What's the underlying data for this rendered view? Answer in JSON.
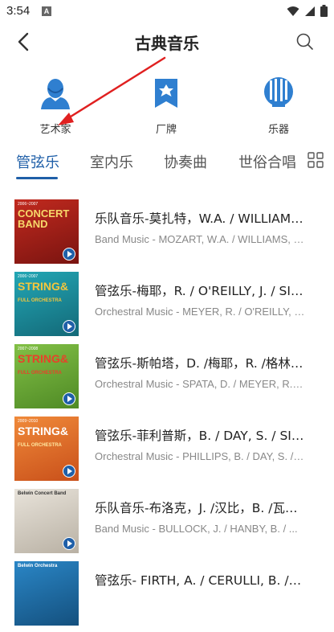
{
  "status_bar": {
    "time": "3:54",
    "notification_letter": "A"
  },
  "header": {
    "title": "古典音乐",
    "back_icon": "chevron-left-icon",
    "search_icon": "search-icon"
  },
  "categories": [
    {
      "label": "艺术家",
      "icon": "artist-icon",
      "color": "#2f7fd0"
    },
    {
      "label": "厂牌",
      "icon": "label-badge-icon",
      "color": "#2f7fd0"
    },
    {
      "label": "乐器",
      "icon": "organ-pipes-icon",
      "color": "#2f7fd0"
    }
  ],
  "tabs": [
    {
      "label": "管弦乐",
      "active": true
    },
    {
      "label": "室内乐",
      "active": false
    },
    {
      "label": "协奏曲",
      "active": false
    },
    {
      "label": "世俗合唱",
      "active": false
    }
  ],
  "accent_color": "#1f5fa8",
  "annotation_arrow_color": "#e02020",
  "items": [
    {
      "title": "乐队音乐-莫扎特，W.A. / WILLIAMS, J. / C...",
      "subtitle": "Band Music - MOZART, W.A. / WILLIAMS, J. / ...",
      "cover_top": "2006~2007",
      "cover_big": "CONCERT BAND",
      "cover_small": "",
      "cover_bg": "#b0231c"
    },
    {
      "title": "管弦乐-梅耶，R. / O'REILLY, J. / SIEBERT, ...",
      "subtitle": "Orchestral Music - MEYER, R. / O'REILLY, J. / ...",
      "cover_top": "2006~2007",
      "cover_big": "STRING&",
      "cover_small": "FULL ORCHESTRA",
      "cover_bg": "#1d8fa0"
    },
    {
      "title": "管弦乐-斯帕塔，D. /梅耶，R. /格林伍德，...",
      "subtitle": "Orchestral Music - SPATA, D. / MEYER, R. / ...",
      "cover_top": "2007~2008",
      "cover_big": "STRING&",
      "cover_small": "FULL ORCHESTRA",
      "cover_bg": "#6fae3a"
    },
    {
      "title": "管弦乐-菲利普斯，B. / DAY, S. / SIEBERT, ...",
      "subtitle": "Orchestral Music - PHILLIPS, B. / DAY, S. / S...",
      "cover_top": "2009~2010",
      "cover_big": "STRING&",
      "cover_small": "FULL ORCHESTRA",
      "cover_bg": "#e5702a"
    },
    {
      "title": "乐队音乐-布洛克，J. /汉比，B. /瓦尔特，...",
      "subtitle": "Band Music - BULLOCK, J. / HANBY, B. / ...",
      "cover_top": "Belwin Concert Band",
      "cover_big": "",
      "cover_small": "",
      "cover_bg": "#d9d4cc"
    },
    {
      "title": "管弦乐- FIRTH, A. / CERULLI, B. / P...",
      "subtitle": "",
      "cover_top": "Belwin Orchestra",
      "cover_big": "",
      "cover_small": "",
      "cover_bg": "#1f6fa8"
    }
  ]
}
